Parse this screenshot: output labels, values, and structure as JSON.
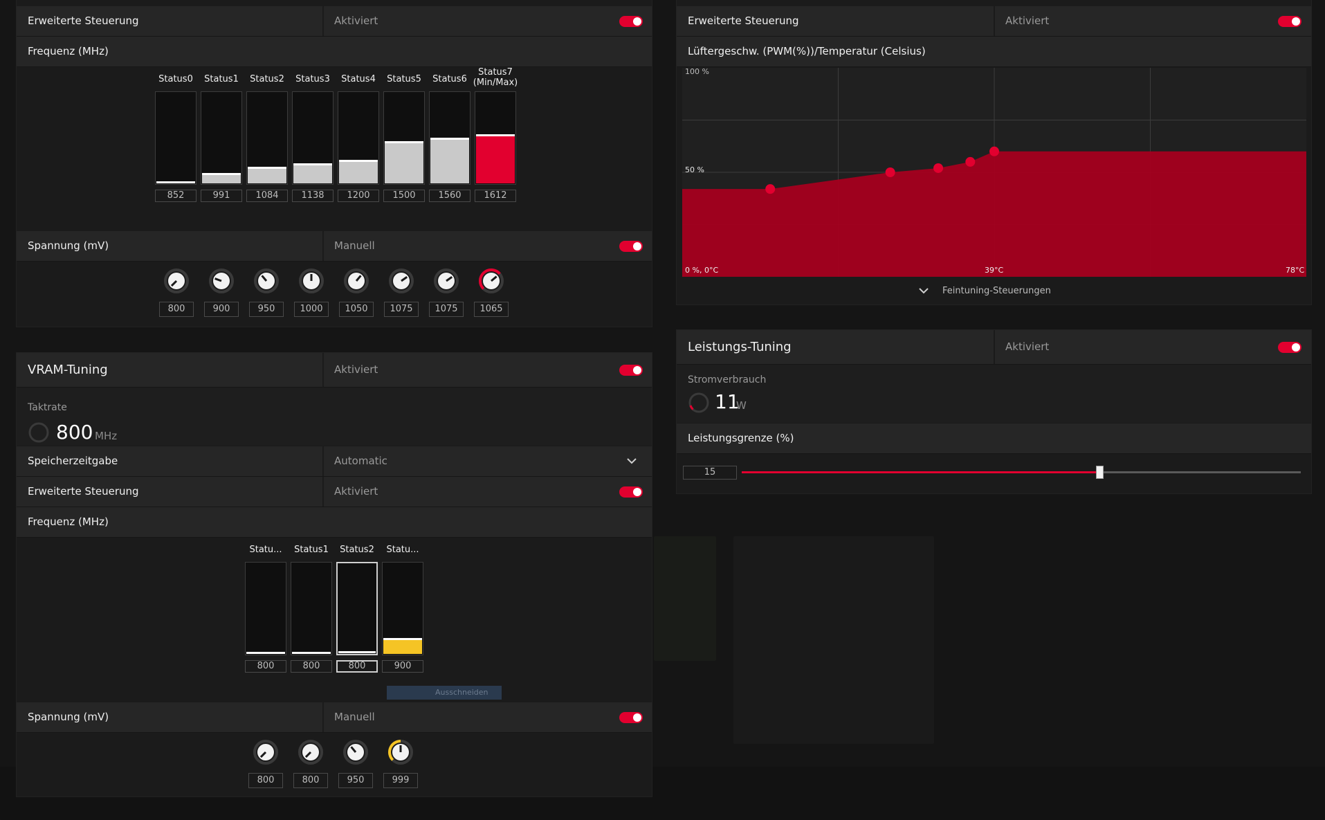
{
  "accent": "#e2002f",
  "gpu": {
    "advanced_label": "Erweiterte Steuerung",
    "advanced_value": "Aktiviert",
    "frequency_label": "Frequenz (MHz)",
    "states": [
      {
        "name": "Status0",
        "value": "852",
        "level": 0.0
      },
      {
        "name": "Status1",
        "value": "991",
        "level": 0.09
      },
      {
        "name": "Status2",
        "value": "1084",
        "level": 0.16
      },
      {
        "name": "Status3",
        "value": "1138",
        "level": 0.2
      },
      {
        "name": "Status4",
        "value": "1200",
        "level": 0.24
      },
      {
        "name": "Status5",
        "value": "1500",
        "level": 0.44
      },
      {
        "name": "Status6",
        "value": "1560",
        "level": 0.48
      },
      {
        "name": "Status7",
        "name2": "(Min/Max)",
        "value": "1612",
        "level": 0.52
      }
    ],
    "voltage_label": "Spannung (mV)",
    "voltage_mode": "Manuell",
    "voltages": [
      {
        "value": "800",
        "angle": -135
      },
      {
        "value": "900",
        "angle": -70
      },
      {
        "value": "950",
        "angle": -40
      },
      {
        "value": "1000",
        "angle": 0
      },
      {
        "value": "1050",
        "angle": 40
      },
      {
        "value": "1075",
        "angle": 55
      },
      {
        "value": "1075",
        "angle": 55
      },
      {
        "value": "1065",
        "angle": 50
      }
    ]
  },
  "vram": {
    "title": "VRAM-Tuning",
    "title_value": "Aktiviert",
    "clock_label": "Taktrate",
    "clock_value": "800",
    "clock_unit": "MHz",
    "timing_label": "Speicherzeitgabe",
    "timing_value": "Automatic",
    "advanced_label": "Erweiterte Steuerung",
    "advanced_value": "Aktiviert",
    "frequency_label": "Frequenz (MHz)",
    "states": [
      {
        "name": "Statu...",
        "value": "800",
        "level": 0.0
      },
      {
        "name": "Status1",
        "value": "800",
        "level": 0.0
      },
      {
        "name": "Status2",
        "value": "800",
        "level": 0.0
      },
      {
        "name": "Statu...",
        "value": "900",
        "level": 0.15
      }
    ],
    "tooltip": "Ausschneiden",
    "voltage_label": "Spannung (mV)",
    "voltage_mode": "Manuell",
    "voltages": [
      {
        "value": "800",
        "angle": -135
      },
      {
        "value": "800",
        "angle": -135
      },
      {
        "value": "950",
        "angle": -40
      },
      {
        "value": "999",
        "angle": 0
      }
    ]
  },
  "fan": {
    "advanced_label": "Erweiterte Steuerung",
    "advanced_value": "Aktiviert",
    "chart_title": "Lüftergeschw. (PWM(%))/Temperatur (Celsius)",
    "y_top": "100 %",
    "y_mid": "50 %",
    "origin": "0 %, 0°C",
    "x_mid": "39°C",
    "x_max": "78°C",
    "fine_tuning": "Feintuning-Steuerungen"
  },
  "chart_data": {
    "type": "area",
    "title": "Lüftergeschw. (PWM(%))/Temperatur (Celsius)",
    "xlabel": "",
    "ylabel": "",
    "xlim": [
      0,
      78
    ],
    "ylim": [
      0,
      100
    ],
    "series": [
      {
        "x": [
          0,
          11,
          26,
          32,
          36,
          39,
          78
        ],
        "y": [
          42,
          42,
          50,
          52,
          55,
          60,
          60
        ]
      }
    ]
  },
  "power": {
    "title": "Leistungs-Tuning",
    "title_value": "Aktiviert",
    "consumption_label": "Stromverbrauch",
    "consumption_value": "11",
    "consumption_unit": "W",
    "limit_label": "Leistungsgrenze (%)",
    "limit_value": "15",
    "limit_fraction": 0.64
  }
}
